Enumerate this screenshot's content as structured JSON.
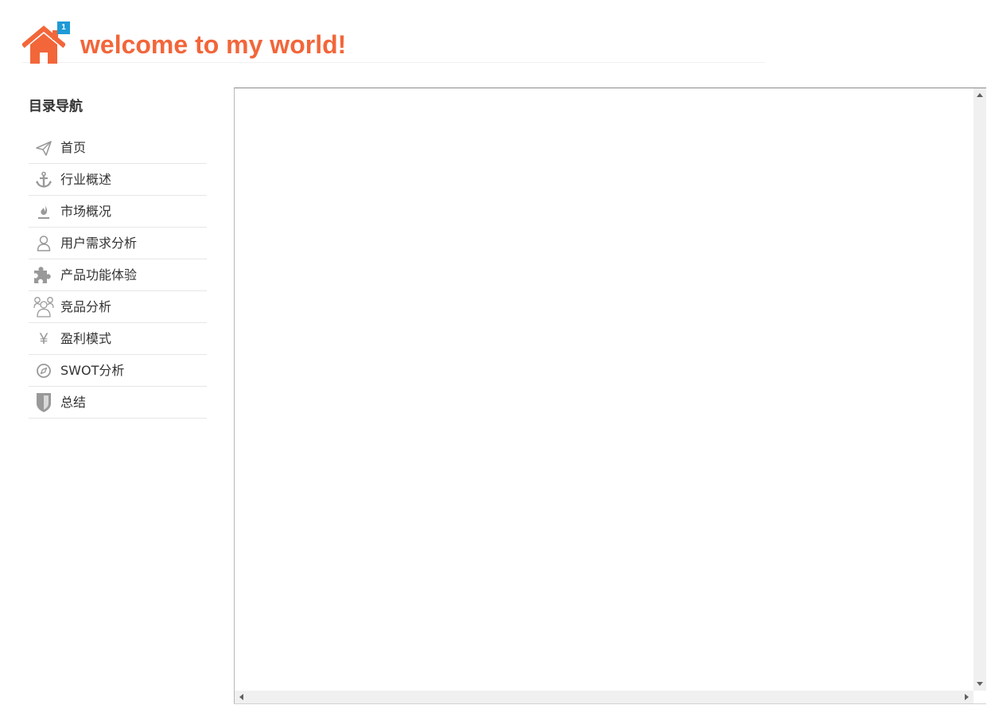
{
  "header": {
    "title": "welcome to my world!",
    "badge": "1",
    "icon": "home-icon",
    "accent_color": "#f2663a",
    "badge_color": "#1e9ad6"
  },
  "sidebar": {
    "heading": "目录导航",
    "items": [
      {
        "label": "首页",
        "icon": "paper-plane-icon"
      },
      {
        "label": "行业概述",
        "icon": "anchor-icon"
      },
      {
        "label": "市场概况",
        "icon": "fire-icon"
      },
      {
        "label": "用户需求分析",
        "icon": "user-icon"
      },
      {
        "label": "产品功能体验",
        "icon": "puzzle-icon"
      },
      {
        "label": "竞品分析",
        "icon": "users-icon"
      },
      {
        "label": "盈利模式",
        "icon": "yen-icon"
      },
      {
        "label": "SWOT分析",
        "icon": "compass-icon"
      },
      {
        "label": "总结",
        "icon": "shield-icon"
      }
    ]
  },
  "content_frame": {
    "icon_color": "#999999"
  }
}
